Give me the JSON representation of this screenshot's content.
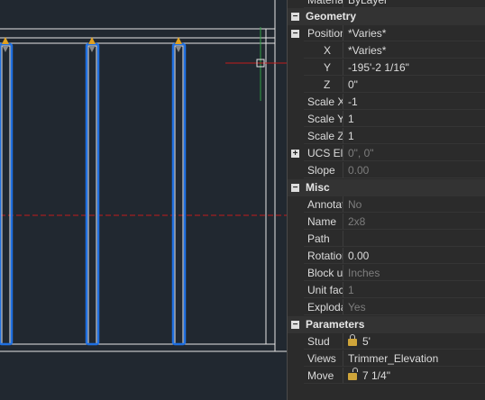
{
  "canvas": {
    "crosshair_color": "#c21b1b",
    "ortho_axis_color": "#2ea043",
    "selection_color": "#1f6fe0",
    "grip_color": "#e0a020",
    "stud_count": 3
  },
  "properties": {
    "top_partial": {
      "name": "Material",
      "value": "ByLayer"
    },
    "sections": [
      {
        "title": "Geometry",
        "rows": [
          {
            "name": "Position",
            "value": "*Varies*",
            "expandable": "minus"
          },
          {
            "name": "X",
            "value": "*Varies*",
            "sub": true
          },
          {
            "name": "Y",
            "value": "-195'-2 1/16\"",
            "sub": true
          },
          {
            "name": "Z",
            "value": "0\"",
            "sub": true
          },
          {
            "name": "Scale X",
            "value": "-1"
          },
          {
            "name": "Scale Y",
            "value": "1"
          },
          {
            "name": "Scale Z",
            "value": "1"
          },
          {
            "name": "UCS Ele",
            "value": "0\", 0\"",
            "dim": true,
            "expandable": "plus"
          },
          {
            "name": "Slope",
            "value": "0.00",
            "dim": true
          }
        ]
      },
      {
        "title": "Misc",
        "rows": [
          {
            "name": "Annotat",
            "value": "No",
            "dim": true
          },
          {
            "name": "Name",
            "value": "2x8",
            "dim": true
          },
          {
            "name": "Path",
            "value": ""
          },
          {
            "name": "Rotation",
            "value": "0.00"
          },
          {
            "name": "Block ur",
            "value": "Inches",
            "dim": true
          },
          {
            "name": "Unit fac",
            "value": "1",
            "dim": true
          },
          {
            "name": "Exploda",
            "value": "Yes",
            "dim": true
          }
        ]
      },
      {
        "title": "Parameters",
        "rows": [
          {
            "name": "Stud",
            "value": "5'",
            "icon": "lock-icon"
          },
          {
            "name": "Views",
            "value": "Trimmer_Elevation"
          },
          {
            "name": "Move",
            "value": "7 1/4\"",
            "icon": "unlock-icon"
          }
        ]
      }
    ]
  }
}
